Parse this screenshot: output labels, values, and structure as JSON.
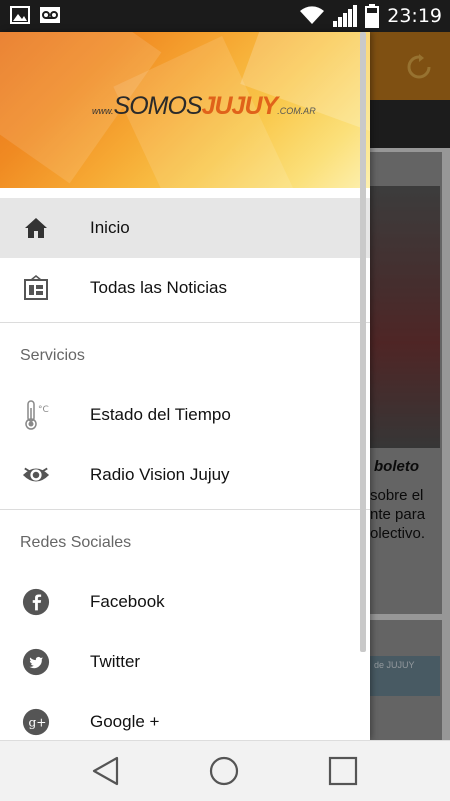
{
  "status": {
    "time": "23:19"
  },
  "header": {
    "logo_www": "www.",
    "logo_somos": "SOMOS",
    "logo_jujuy": "JUJUY",
    "logo_com": ".COM.AR"
  },
  "menu": {
    "inicio": "Inicio",
    "todas": "Todas las Noticias",
    "servicios": "Servicios",
    "tiempo": "Estado del Tiempo",
    "radio": "Radio Vision Jujuy",
    "redes": "Redes Sociales",
    "facebook": "Facebook",
    "twitter": "Twitter",
    "google": "Google +"
  },
  "background": {
    "card_title": "boleto",
    "card_lines": [
      "sobre el",
      "nte para",
      "olectivo."
    ],
    "ad_text": "de JUJUY"
  },
  "colors": {
    "accent": "#f08a22",
    "brand_dark": "#e0621a",
    "active_bg": "#e6e6e6"
  }
}
